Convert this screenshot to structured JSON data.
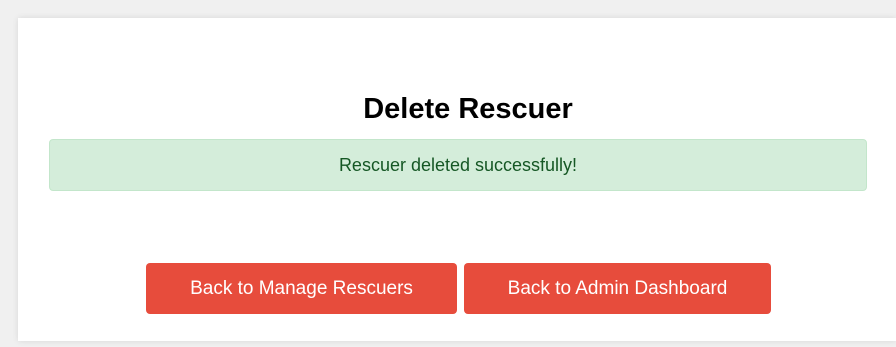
{
  "page": {
    "title": "Delete Rescuer",
    "alert_message": "Rescuer deleted successfully!"
  },
  "actions": {
    "back_manage_label": "Back to Manage Rescuers",
    "back_dashboard_label": "Back to Admin Dashboard"
  },
  "colors": {
    "page_bg": "#f0f0f0",
    "card_bg": "#ffffff",
    "alert_bg": "#d4edda",
    "alert_border": "#c3e6cb",
    "alert_text": "#155724",
    "button_bg": "#e74c3c",
    "button_text": "#ffffff"
  }
}
